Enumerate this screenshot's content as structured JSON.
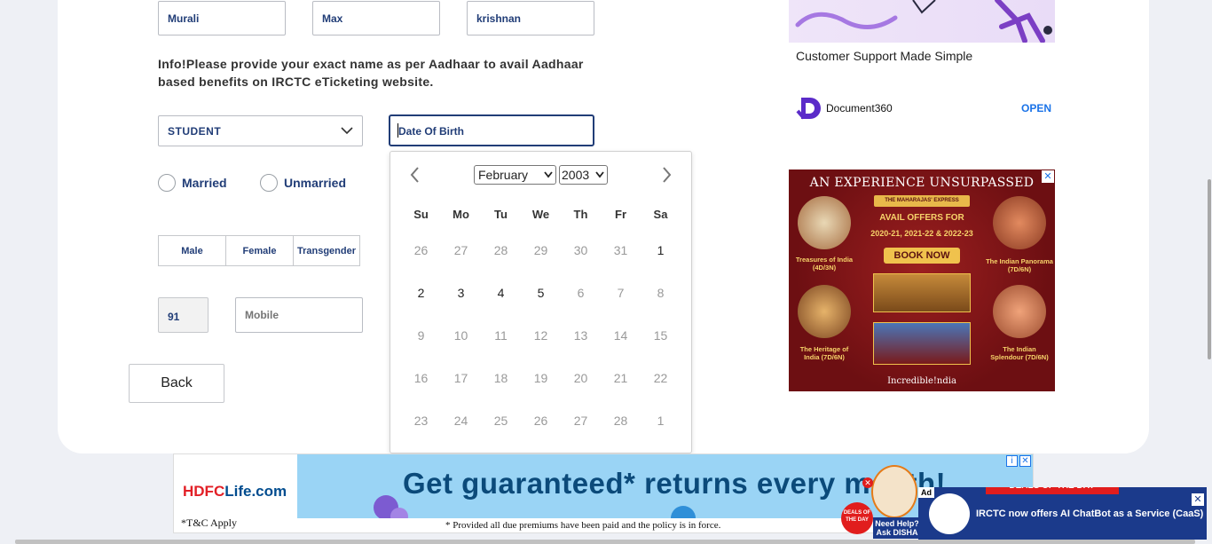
{
  "form": {
    "first_name": "Murali",
    "middle_name": "Max",
    "last_name": "krishnan",
    "info_text": "Info!Please provide your exact name as per Aadhaar to avail Aadhaar based benefits on IRCTC eTicketing website.",
    "occupation": "STUDENT",
    "dob_placeholder": "Date Of Birth",
    "marital": [
      "Married",
      "Unmarried"
    ],
    "gender": [
      "Male",
      "Female",
      "Transgender"
    ],
    "country_code": "91",
    "mobile_placeholder": "Mobile",
    "back_label": "Back"
  },
  "calendar": {
    "month": "February",
    "year": "2003",
    "weekdays": [
      "Su",
      "Mo",
      "Tu",
      "We",
      "Th",
      "Fr",
      "Sa"
    ],
    "weeks": [
      [
        {
          "d": "26",
          "on": false
        },
        {
          "d": "27",
          "on": false
        },
        {
          "d": "28",
          "on": false
        },
        {
          "d": "29",
          "on": false
        },
        {
          "d": "30",
          "on": false
        },
        {
          "d": "31",
          "on": false
        },
        {
          "d": "1",
          "on": true
        }
      ],
      [
        {
          "d": "2",
          "on": true
        },
        {
          "d": "3",
          "on": true
        },
        {
          "d": "4",
          "on": true
        },
        {
          "d": "5",
          "on": true
        },
        {
          "d": "6",
          "on": false
        },
        {
          "d": "7",
          "on": false
        },
        {
          "d": "8",
          "on": false
        }
      ],
      [
        {
          "d": "9",
          "on": false
        },
        {
          "d": "10",
          "on": false
        },
        {
          "d": "11",
          "on": false
        },
        {
          "d": "12",
          "on": false
        },
        {
          "d": "13",
          "on": false
        },
        {
          "d": "14",
          "on": false
        },
        {
          "d": "15",
          "on": false
        }
      ],
      [
        {
          "d": "16",
          "on": false
        },
        {
          "d": "17",
          "on": false
        },
        {
          "d": "18",
          "on": false
        },
        {
          "d": "19",
          "on": false
        },
        {
          "d": "20",
          "on": false
        },
        {
          "d": "21",
          "on": false
        },
        {
          "d": "22",
          "on": false
        }
      ],
      [
        {
          "d": "23",
          "on": false
        },
        {
          "d": "24",
          "on": false
        },
        {
          "d": "25",
          "on": false
        },
        {
          "d": "26",
          "on": false
        },
        {
          "d": "27",
          "on": false
        },
        {
          "d": "28",
          "on": false
        },
        {
          "d": "1",
          "on": false
        }
      ]
    ]
  },
  "ad_top": {
    "tagline": "Customer Support Made Simple",
    "brand": "Document360",
    "cta": "OPEN"
  },
  "ad_side": {
    "headline": "An Experience Unsurpassed",
    "banner": "THE MAHARAJAS' EXPRESS",
    "offer": "AVAIL OFFERS FOR",
    "years": "2020-21, 2021-22 & 2022-23",
    "cta": "BOOK NOW",
    "tours": [
      "Treasures of India (4D/3N)",
      "The Indian Panorama (7D/6N)",
      "The Heritage of India (7D/6N)",
      "The Indian Splendour (7D/6N)"
    ],
    "footer": "Incredible!ndia"
  },
  "ad_bottom": {
    "brand_red": "HDFC",
    "brand_blue": "Life",
    "brand_suffix": ".com",
    "tc": "*T&C Apply",
    "headline": "Get guaranteed* returns every month!",
    "fine_print": "* Provided all due premiums have been paid and the policy is in force."
  },
  "disha": {
    "label": "Need Help? Ask DISHA",
    "deal": "DEALS OF THE DAY"
  },
  "irctc_ad": {
    "ad_tag": "Ad",
    "deal": "DEALS OF THE DAY",
    "text": "IRCTC now offers AI ChatBot as a Service (CaaS)"
  },
  "colors": {
    "brand_navy": "#213d77",
    "page_bg": "#eef0f5",
    "hdfc_red": "#e21f26",
    "irctc_blue": "#1b3a8b"
  }
}
